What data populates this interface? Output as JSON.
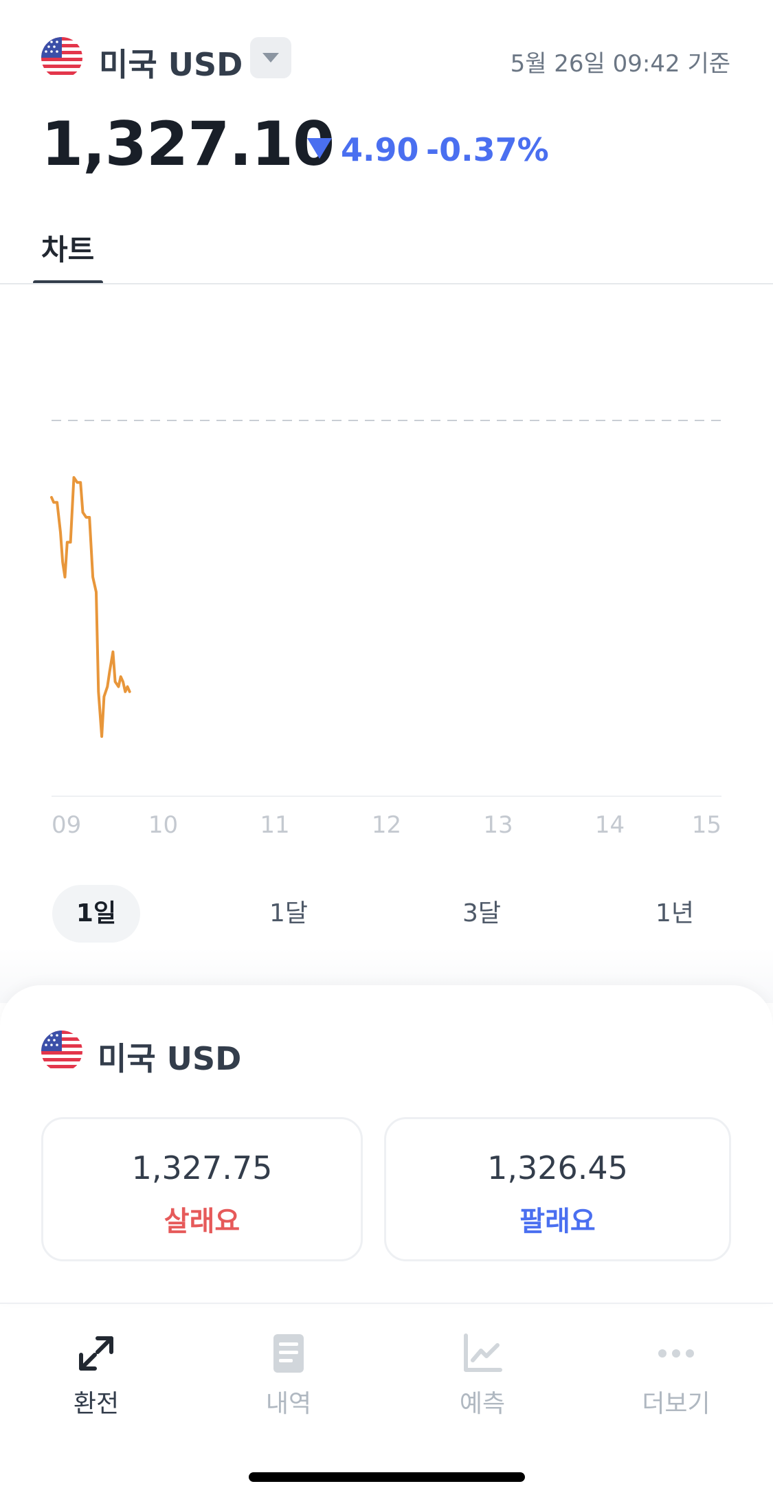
{
  "header": {
    "currency_title": "미국 USD",
    "flag_icon": "us-flag-icon",
    "dropdown_icon": "caret-down-icon",
    "timestamp": "5월 26일 09:42 기준"
  },
  "quote": {
    "rate": "1,327.10",
    "change_direction_icon": "down-triangle-icon",
    "change_abs": "4.90",
    "change_pct": "-0.37%",
    "change_color": "#4a6ff0"
  },
  "tabs": [
    {
      "label": "차트",
      "active": true
    }
  ],
  "chart_data": {
    "type": "line",
    "series_color": "#e8963a",
    "reference_line": "dashed",
    "x_ticks": [
      "09",
      "10",
      "11",
      "12",
      "13",
      "14",
      "15"
    ],
    "x_range": [
      9.0,
      15.0
    ],
    "y_range": [
      0,
      100
    ],
    "x": [
      9.0,
      9.02,
      9.05,
      9.08,
      9.1,
      9.12,
      9.14,
      9.17,
      9.2,
      9.23,
      9.26,
      9.28,
      9.31,
      9.34,
      9.37,
      9.4,
      9.42,
      9.45,
      9.47,
      9.5,
      9.52,
      9.55,
      9.57,
      9.6,
      9.62,
      9.64,
      9.66,
      9.68,
      9.7
    ],
    "values": [
      60,
      59,
      59,
      53,
      47,
      44,
      51,
      51,
      64,
      63,
      63,
      57,
      56,
      56,
      44,
      41,
      21,
      12,
      20,
      22,
      25,
      29,
      23,
      22,
      24,
      23,
      21,
      22,
      21
    ]
  },
  "ranges": [
    {
      "label": "1일",
      "active": true
    },
    {
      "label": "1달",
      "active": false
    },
    {
      "label": "3달",
      "active": false
    },
    {
      "label": "1년",
      "active": false
    }
  ],
  "sheet": {
    "currency_title": "미국 USD",
    "buy_price": "1,327.75",
    "buy_label": "살래요",
    "buy_color": "#e65a5a",
    "sell_price": "1,326.45",
    "sell_label": "팔래요",
    "sell_color": "#4a6ff0"
  },
  "nav": [
    {
      "label": "환전",
      "icon": "exchange-arrows-icon",
      "active": true
    },
    {
      "label": "내역",
      "icon": "document-icon",
      "active": false
    },
    {
      "label": "예측",
      "icon": "line-chart-icon",
      "active": false
    },
    {
      "label": "더보기",
      "icon": "more-dots-icon",
      "active": false
    }
  ]
}
